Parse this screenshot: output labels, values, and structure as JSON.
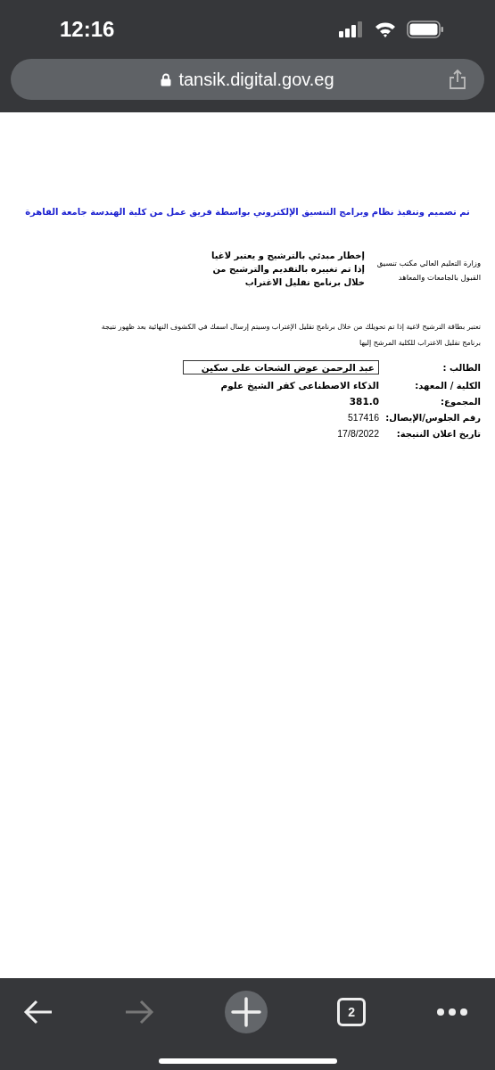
{
  "status_bar": {
    "time": "12:16"
  },
  "address_bar": {
    "url": "tansik.digital.gov.eg"
  },
  "page": {
    "banner": "تم تصميم وتنفيذ نظام وبرامج التنسيق الإلكتروني بواسطة فريق عمل من كلية الهندسة جامعة القاهرة",
    "ministry": "وزارة التعليم العالي مكتب تنسيق القبول بالجامعات والمعاهد",
    "notice_title": "إخطار مبدئي بالترشيح و يعتبر لاغيا إذا تم تغييره بالتقديم والترشيح من خلال برنامج تقليل الاغتراب",
    "notice_text": "تعتبر بطاقة الترشيح لاغية إذا تم تحويلك من خلال برنامج تقليل الإغتراب وسيتم إرسال اسمك في الكشوف النهائية بعد ظهور نتيجة برنامج تقليل الاغتراب للكلية المرشح إليها",
    "fields": [
      {
        "kind": "boxed",
        "label": "الطالب :",
        "value": "عبد الرحمن عوض الشحات على سكين"
      },
      {
        "kind": "bold",
        "label": "الكلية / المعهد:",
        "value": "الذكاء الاصطناعى كفر الشيخ علوم"
      },
      {
        "kind": "bold",
        "label": "المجموع:",
        "value": "381.0"
      },
      {
        "kind": "plain",
        "label": "رقم الجلوس/الإيصال:",
        "value": "517416"
      },
      {
        "kind": "plain",
        "label": "تاريخ اعلان النتيجة:",
        "value": "17/8/2022"
      }
    ]
  },
  "toolbar": [
    {
      "kind": "back",
      "disabled": false
    },
    {
      "kind": "forward",
      "disabled": true
    },
    {
      "kind": "new_tab",
      "disabled": false
    },
    {
      "kind": "tabs",
      "count": "2",
      "disabled": false
    },
    {
      "kind": "more",
      "disabled": false
    }
  ]
}
